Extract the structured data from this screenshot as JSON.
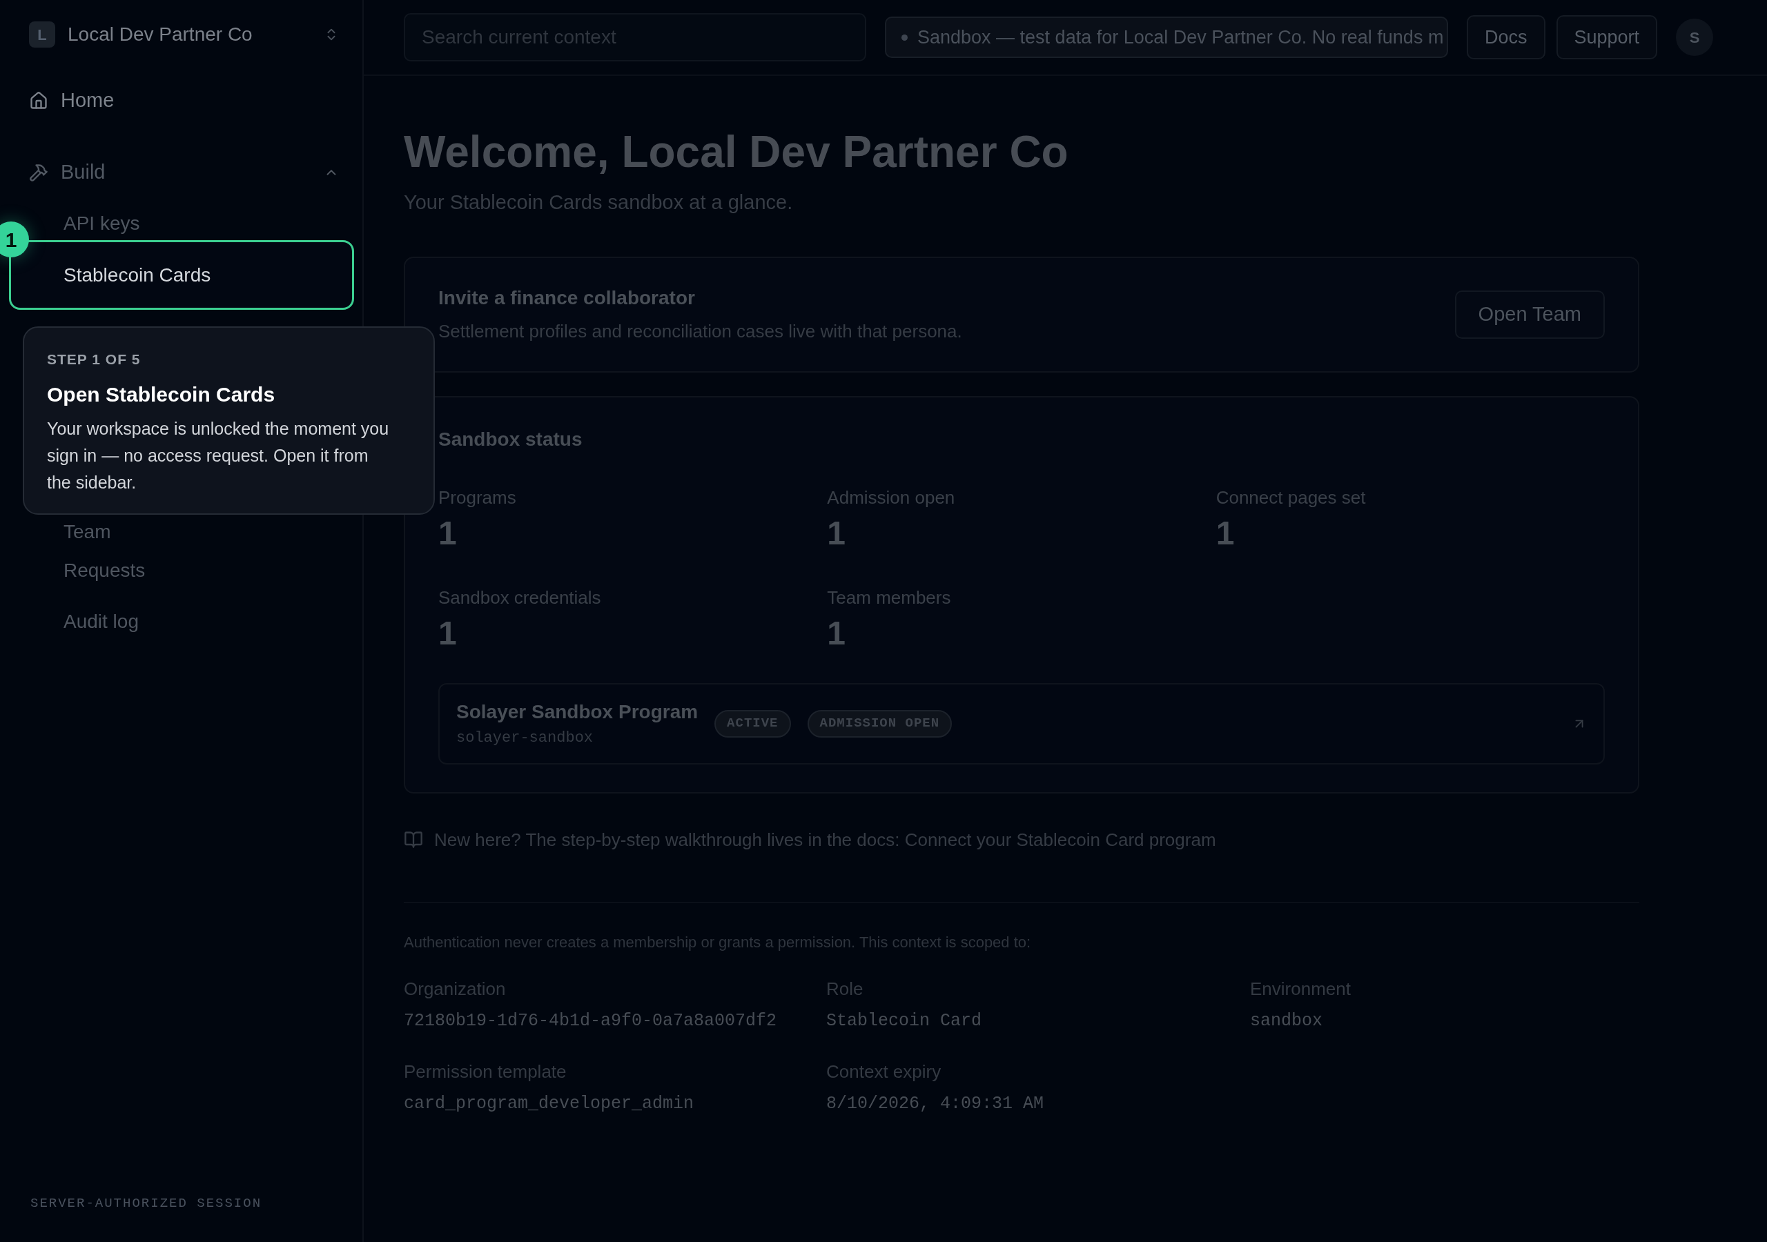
{
  "sidebar": {
    "org": {
      "initial": "L",
      "name": "Local Dev Partner Co"
    },
    "items": [
      {
        "kind": "link",
        "label": "Home"
      },
      {
        "kind": "group",
        "label": "Build",
        "expanded": true,
        "children": [
          {
            "label": "API keys",
            "selected": false
          },
          {
            "label": "Stablecoin Cards",
            "selected": true
          }
        ]
      },
      {
        "kind": "sub",
        "label": "Team"
      },
      {
        "kind": "sub",
        "label": "Requests"
      },
      {
        "kind": "sub",
        "label": "Audit log"
      }
    ],
    "footer": "SERVER-AUTHORIZED SESSION"
  },
  "tour": {
    "badge": "1",
    "step": "STEP 1 OF 5",
    "title": "Open Stablecoin Cards",
    "body": "Your workspace is unlocked the moment you sign in — no access request. Open it from the sidebar."
  },
  "topbar": {
    "search": {
      "placeholder": "Search current context"
    },
    "notice": "Sandbox — test data for Local Dev Partner Co. No real funds m",
    "buttons": [
      "Docs",
      "Support"
    ],
    "avatar": "S"
  },
  "main": {
    "title": "Welcome, Local Dev Partner Co",
    "subtitle": "Your Stablecoin Cards sandbox at a glance.",
    "invite": {
      "title": "Invite a finance collaborator",
      "text": "Settlement profiles and reconciliation cases live with that persona.",
      "button": "Open Team"
    },
    "status": {
      "title": "Sandbox status",
      "stats": [
        {
          "label": "Programs",
          "value": "1"
        },
        {
          "label": "Admission open",
          "value": "1"
        },
        {
          "label": "Connect pages set",
          "value": "1"
        },
        {
          "label": "Sandbox credentials",
          "value": "1"
        },
        {
          "label": "Team members",
          "value": "1"
        }
      ],
      "program": {
        "name": "Solayer Sandbox Program",
        "slug": "solayer-sandbox",
        "tags": [
          "ACTIVE",
          "ADMISSION OPEN"
        ]
      }
    },
    "docs_note": "New here? The step-by-step walkthrough lives in the docs: Connect your Stablecoin Card program",
    "scope": {
      "intro": "Authentication never creates a membership or grants a permission. This context is scoped to:",
      "fields": [
        {
          "label": "Organization",
          "value": "72180b19-1d76-4b1d-a9f0-0a7a8a007df2"
        },
        {
          "label": "Role",
          "value": "Stablecoin Card"
        },
        {
          "label": "Environment",
          "value": "sandbox"
        },
        {
          "label": "Permission template",
          "value": "card_program_developer_admin"
        },
        {
          "label": "Context expiry",
          "value": "8/10/2026, 4:09:31 AM"
        }
      ]
    }
  }
}
